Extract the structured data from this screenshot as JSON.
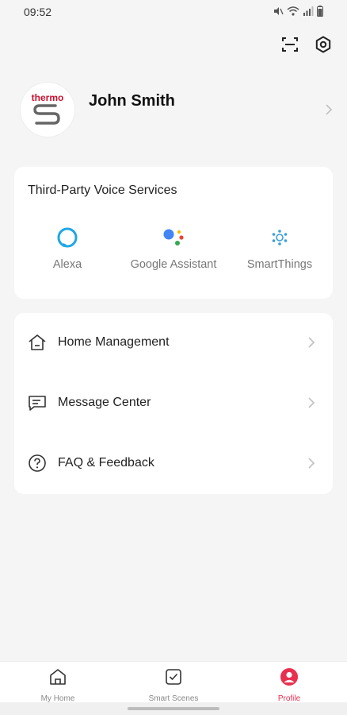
{
  "status": {
    "time": "09:52"
  },
  "header": {
    "scan_icon": "scan-icon",
    "settings_icon": "settings-icon"
  },
  "profile": {
    "name": "John Smith",
    "logo_text": "thermo"
  },
  "voice_services": {
    "title": "Third-Party Voice Services",
    "items": [
      {
        "label": "Alexa",
        "icon": "alexa-icon"
      },
      {
        "label": "Google Assistant",
        "icon": "google-assistant-icon"
      },
      {
        "label": "SmartThings",
        "icon": "smartthings-icon"
      }
    ]
  },
  "menu": {
    "items": [
      {
        "label": "Home Management",
        "icon": "home-icon"
      },
      {
        "label": "Message Center",
        "icon": "message-icon"
      },
      {
        "label": "FAQ & Feedback",
        "icon": "help-icon"
      }
    ]
  },
  "tabbar": {
    "tabs": [
      {
        "label": "My Home",
        "icon": "home-tab-icon"
      },
      {
        "label": "Smart Scenes",
        "icon": "scenes-tab-icon"
      },
      {
        "label": "Profile",
        "icon": "profile-tab-icon"
      }
    ],
    "active_color": "#e8304f"
  },
  "colors": {
    "accent": "#e8304f",
    "background": "#f5f5f5"
  }
}
